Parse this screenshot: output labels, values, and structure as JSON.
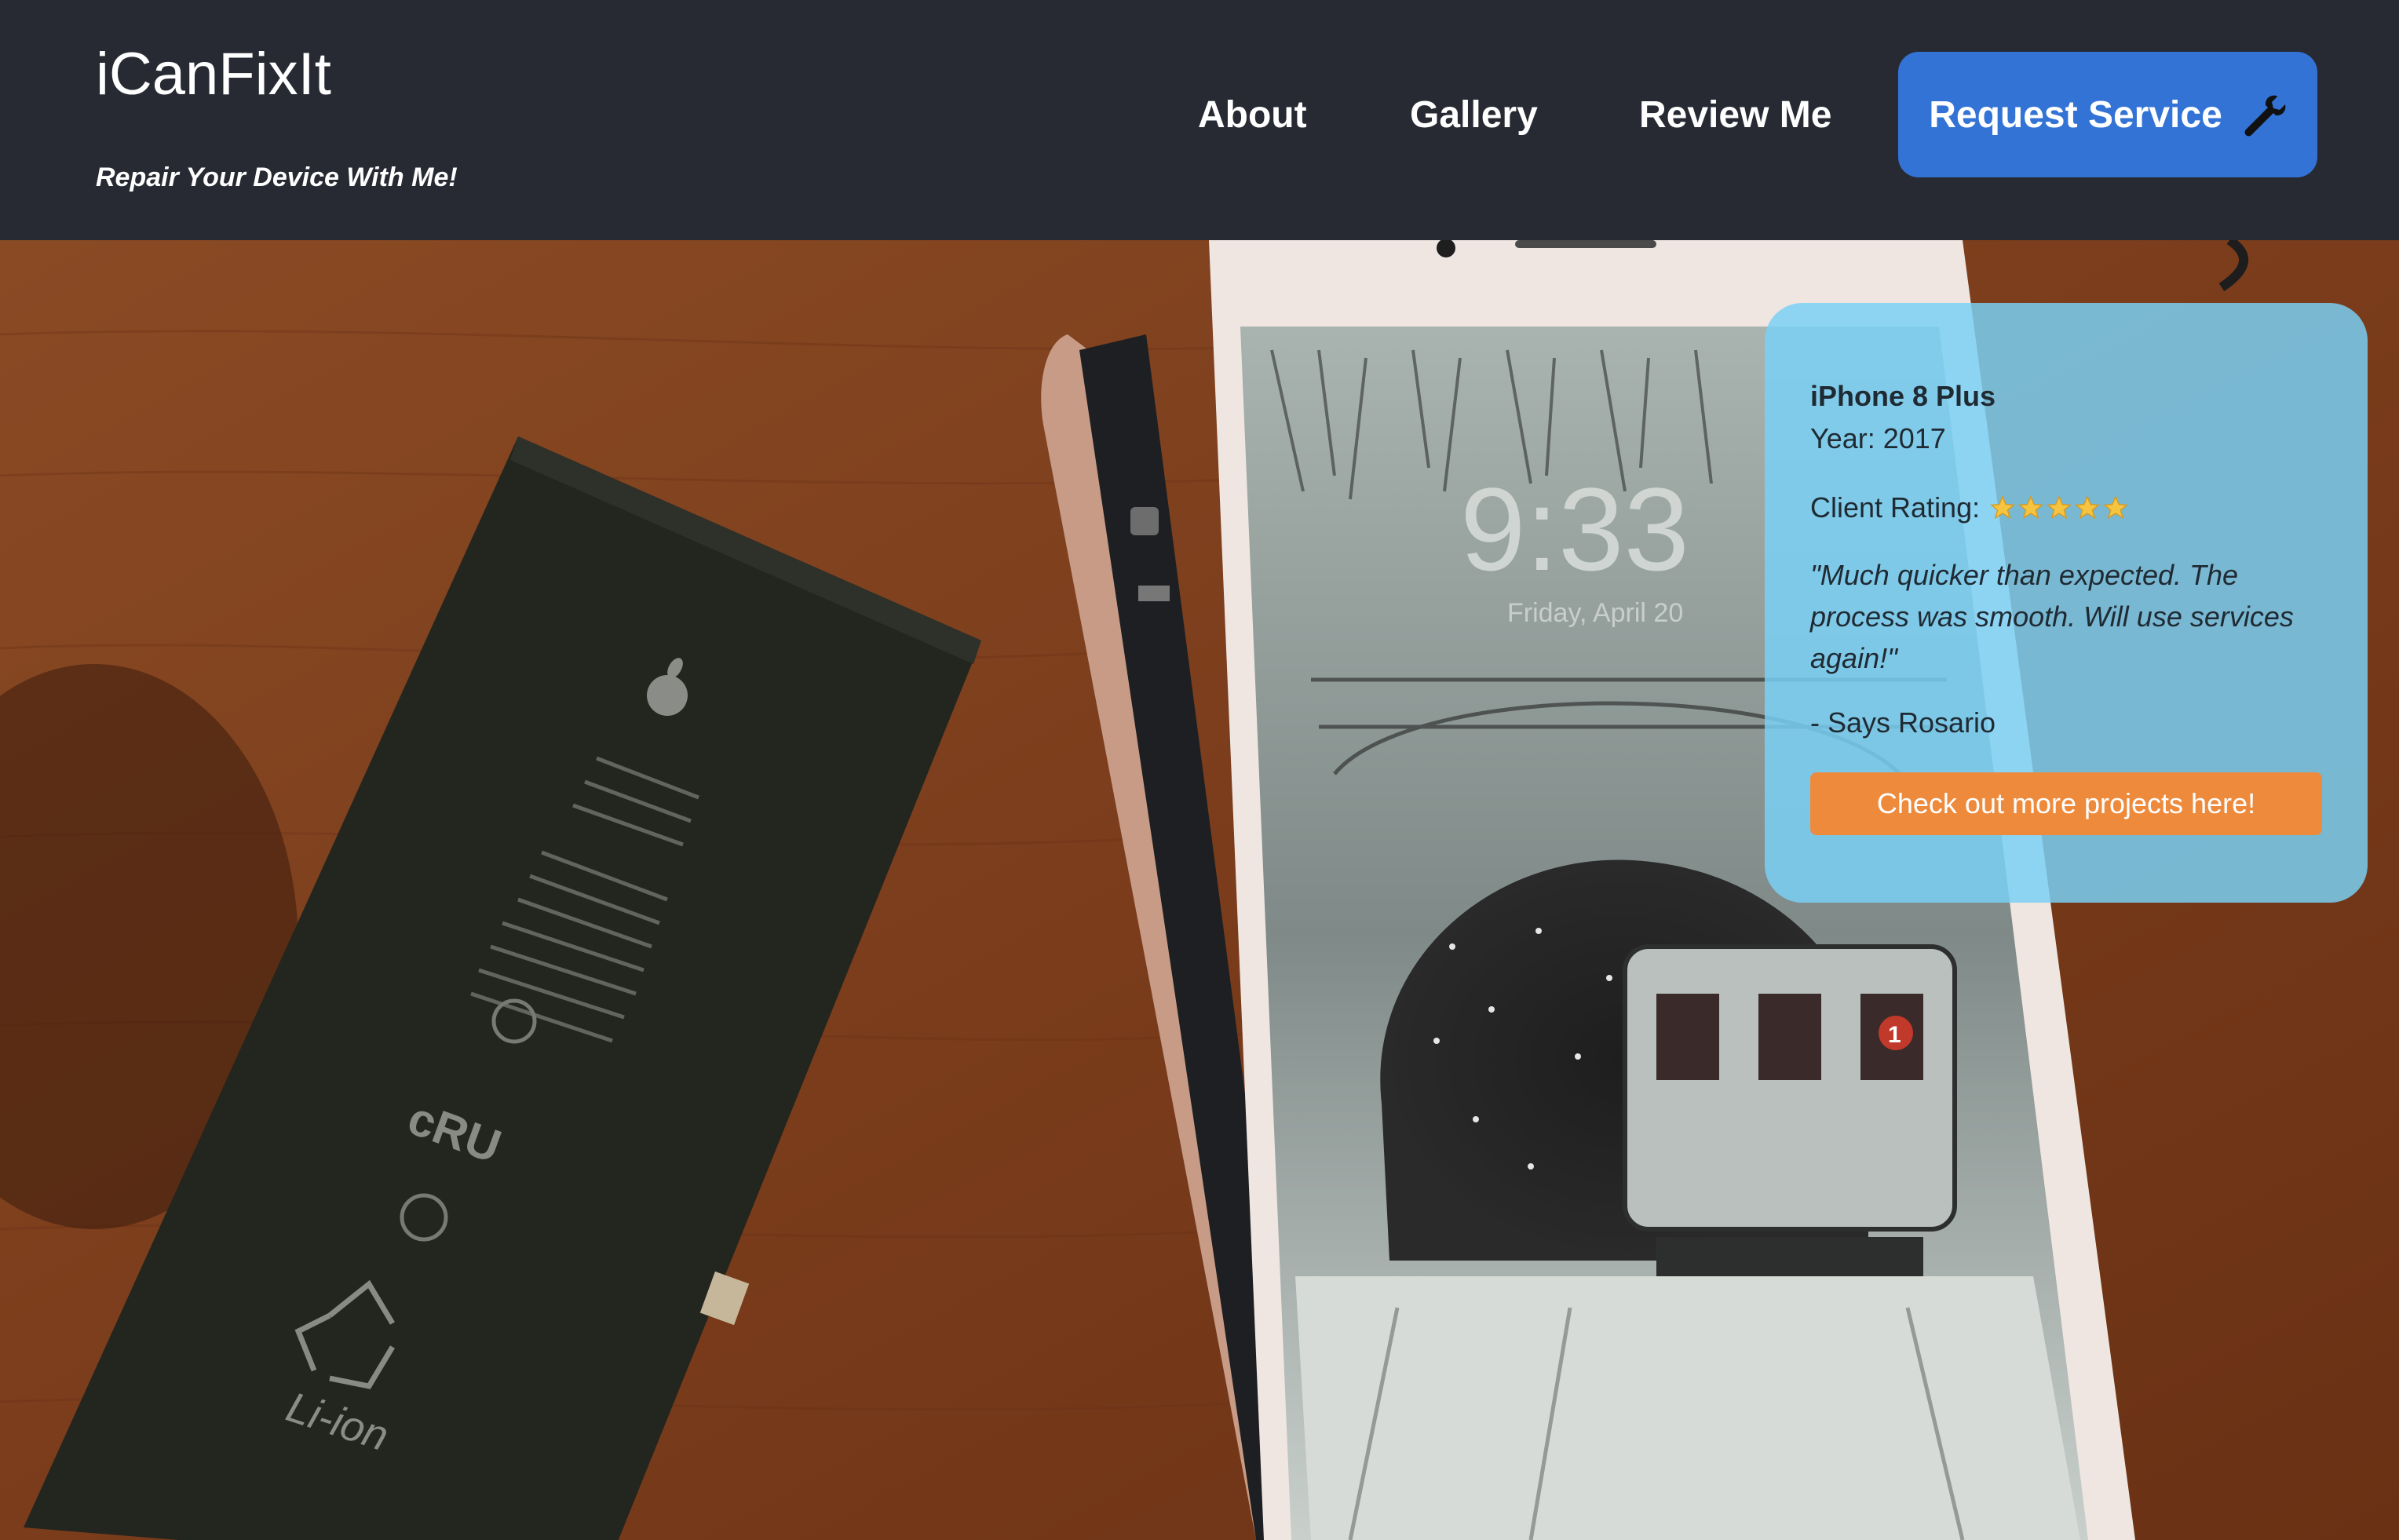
{
  "brand": {
    "title": "iCanFixIt",
    "tagline": "Repair Your Device With Me!"
  },
  "nav": {
    "about": "About",
    "gallery": "Gallery",
    "review": "Review Me",
    "request_service": "Request Service",
    "request_icon": "wrench-icon"
  },
  "review_card": {
    "device": "iPhone 8 Plus",
    "year": "Year: 2017",
    "rating_label": "Client Rating:",
    "rating_stars": 5,
    "rating_max": 5,
    "quote": "\"Much quicker than expected. The process was smooth. Will use services again!\"",
    "author": "- Says Rosario",
    "cta": "Check out more projects here!"
  },
  "colors": {
    "header_bg": "#272a33",
    "accent_blue": "#3373d6",
    "card_bg": "#7ad1f5",
    "cta_orange": "#ee8a3c",
    "star": "#f5c542"
  }
}
